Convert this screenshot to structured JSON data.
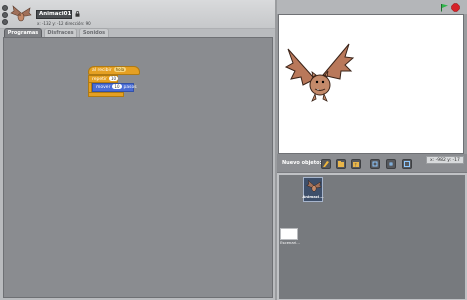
{
  "sprite": {
    "name": "Animaci01",
    "coords": "x: -132  y: -12   dirección: 90"
  },
  "tabs": [
    {
      "label": "Programas"
    },
    {
      "label": "Disfraces"
    },
    {
      "label": "Sonidos"
    }
  ],
  "blocks": {
    "hat": {
      "label": "al recibir",
      "value": "hola"
    },
    "repeat": {
      "label": "repetir",
      "value": "10"
    },
    "move": {
      "label": "mover",
      "value": "10",
      "suffix": "pasos"
    }
  },
  "stage_panel": {
    "new_sprite_label": "Nuevo objeto:",
    "mouse_coords": "x: -982   y: -17"
  },
  "sprites": [
    {
      "name": "Animaci..."
    }
  ],
  "stage_item": {
    "name": "Escenari..."
  },
  "colors": {
    "green_flag": "#2fb54a",
    "stop": "#d6232a",
    "control": "#e5a023",
    "motion": "#4a6cd4"
  },
  "icons": {
    "green_flag": "green-flag-icon",
    "stop": "stop-sign-icon",
    "lock": "lock-icon"
  }
}
